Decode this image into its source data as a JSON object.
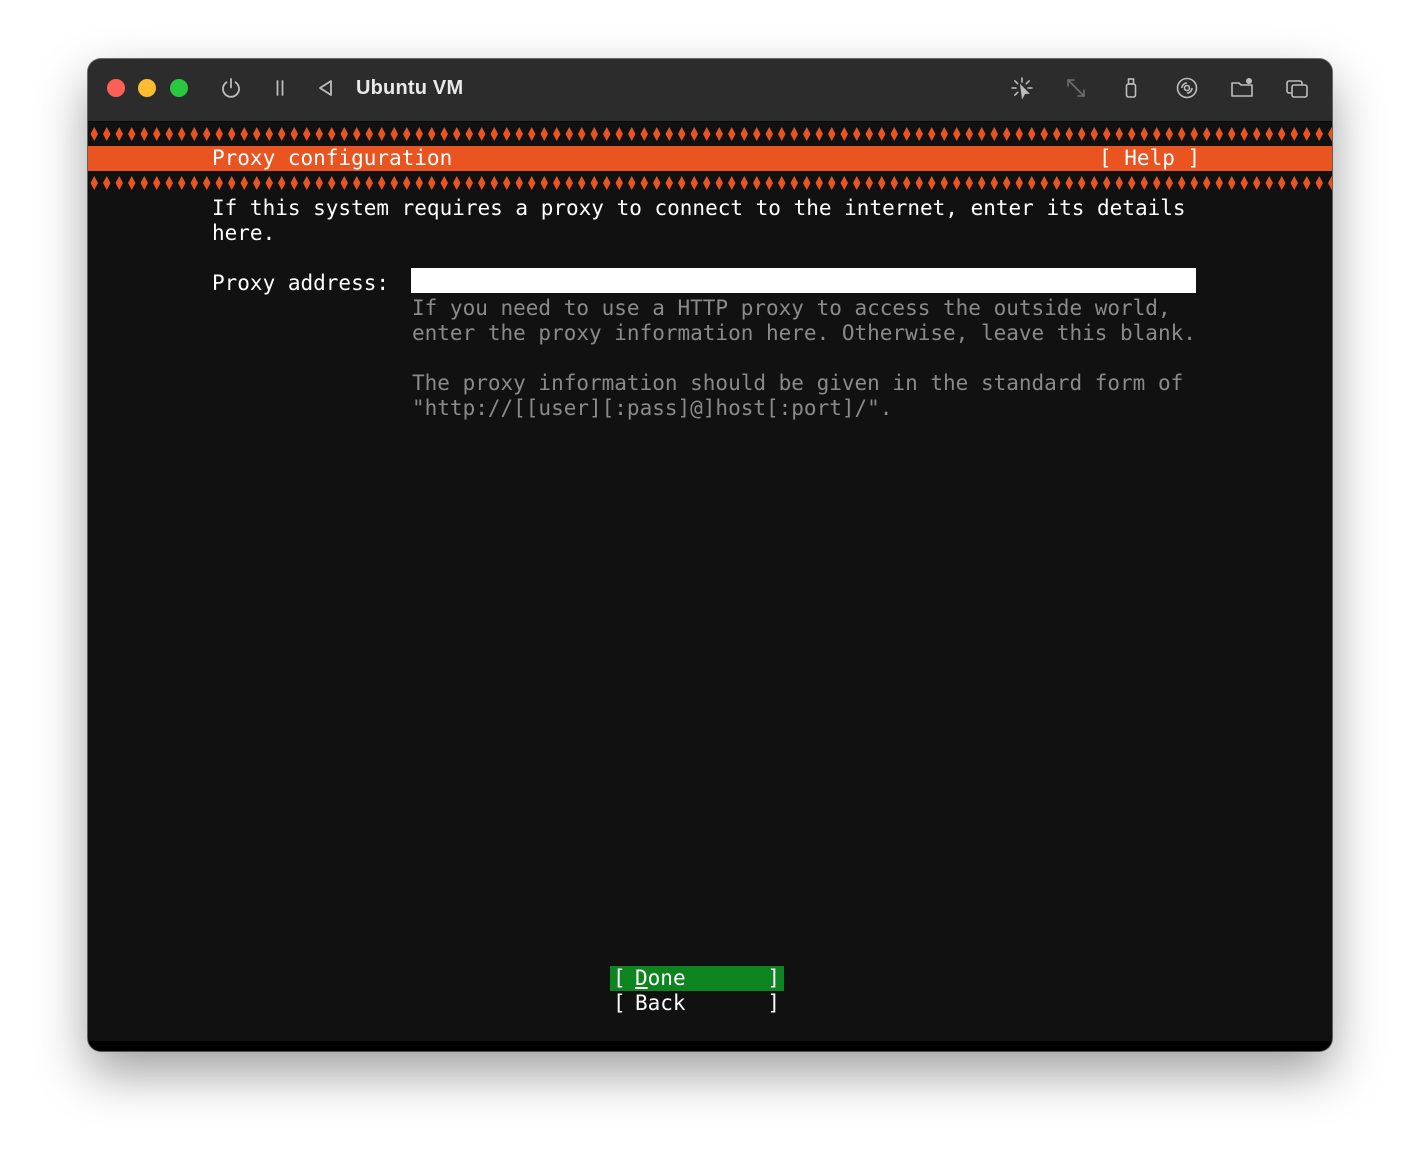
{
  "window": {
    "title": "Ubuntu VM",
    "toolbar_icons": [
      "power-icon",
      "pause-icon",
      "back-triangle-icon",
      "capture-cursor-icon",
      "resize-arrows-icon",
      "usb-icon",
      "disc-icon",
      "shared-folder-icon",
      "windows-icon"
    ]
  },
  "installer": {
    "screen_title": "Proxy configuration",
    "help_label": "[ Help ]",
    "intro": "If this system requires a proxy to connect to the internet, enter its details\nhere.",
    "proxy_field": {
      "label": "Proxy address:",
      "value": "",
      "placeholder": ""
    },
    "help_text_1": "If you need to use a HTTP proxy to access the outside world,\nenter the proxy information here. Otherwise, leave this blank.",
    "help_text_2": "The proxy information should be given in the standard form of\n\"http://[[user][:pass]@]host[:port]/\".",
    "buttons": {
      "done_label": "Done",
      "back_label": "Back",
      "bracket_open": "[",
      "bracket_close": "]"
    }
  },
  "colors": {
    "accent_orange": "#e95420",
    "focus_green": "#0e8420",
    "terminal_bg": "#111111",
    "muted_text": "#8a8a8a"
  }
}
